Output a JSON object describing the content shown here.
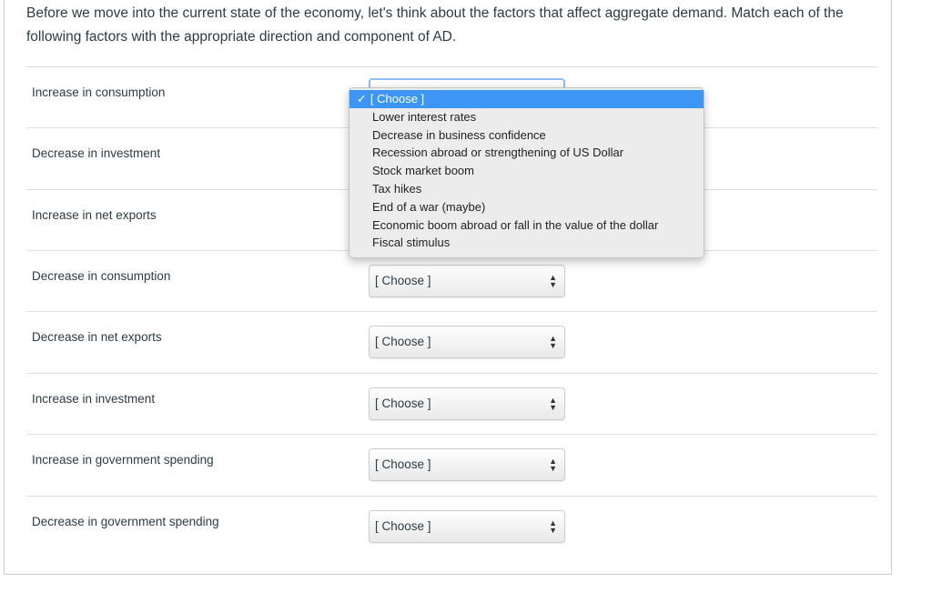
{
  "prompt": "Before we move into the current state of the economy, let's think about the factors that affect aggregate demand.  Match each of the following factors with the appropriate direction and component of AD.",
  "rows": [
    {
      "label": "Increase in consumption",
      "select": "[ Choose ]"
    },
    {
      "label": "Decrease in investment",
      "select": "[ Choose ]"
    },
    {
      "label": "Increase in net exports",
      "select": "[ Choose ]"
    },
    {
      "label": "Decrease in consumption",
      "select": "[ Choose ]"
    },
    {
      "label": "Decrease in net exports",
      "select": "[ Choose ]"
    },
    {
      "label": "Increase in investment",
      "select": "[ Choose ]"
    },
    {
      "label": "Increase in government spending",
      "select": "[ Choose ]"
    },
    {
      "label": "Decrease in government spending",
      "select": "[ Choose ]"
    }
  ],
  "dropdown": {
    "check": "✓",
    "selected": "[ Choose ]",
    "options": [
      "Lower interest rates",
      "Decrease in business confidence",
      "Recession abroad or strengthening of US Dollar",
      "Stock market boom",
      "Tax hikes",
      "End of a war (maybe)",
      "Economic boom abroad or fall in the value of the dollar",
      "Fiscal stimulus"
    ]
  },
  "icons": {
    "updown": "▲▼"
  }
}
